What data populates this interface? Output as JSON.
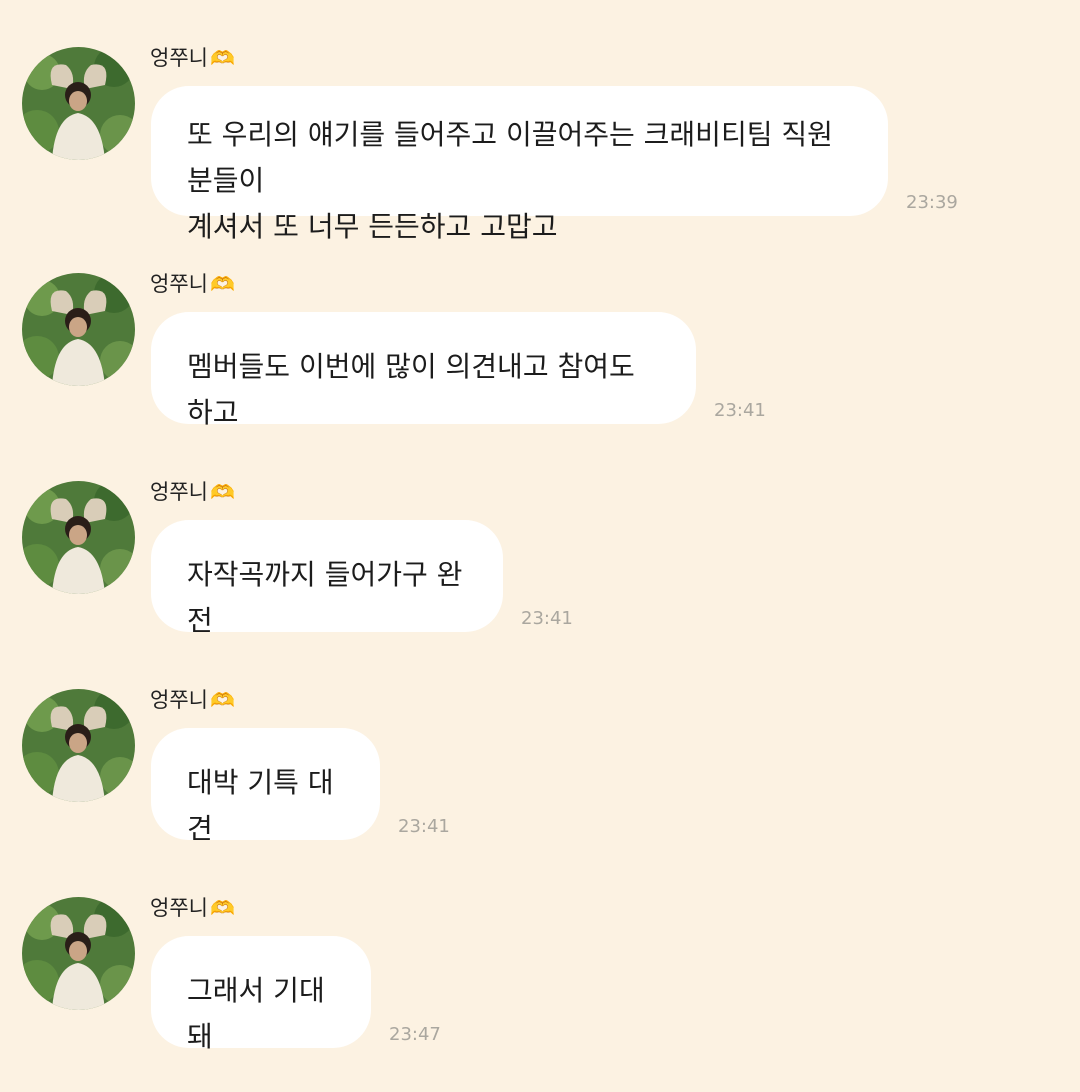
{
  "colors": {
    "background": "#fcf2e2",
    "bubble": "#ffffff",
    "timestamp": "#aaa79f"
  },
  "messages": [
    {
      "sender": "엉쭈니",
      "sender_emoji": "🫶",
      "text": "또 우리의 얘기를 들어주고 이끌어주는 크래비티팀 직원분들이\n계셔서 또 너무 든든하고 고맙고",
      "time": "23:39"
    },
    {
      "sender": "엉쭈니",
      "sender_emoji": "🫶",
      "text": "멤버들도 이번에 많이 의견내고 참여도 하고",
      "time": "23:41"
    },
    {
      "sender": "엉쭈니",
      "sender_emoji": "🫶",
      "text": "자작곡까지 들어가구 완전",
      "time": "23:41"
    },
    {
      "sender": "엉쭈니",
      "sender_emoji": "🫶",
      "text": "대박 기특 대견",
      "time": "23:41"
    },
    {
      "sender": "엉쭈니",
      "sender_emoji": "🫶",
      "text": "그래서 기대돼",
      "time": "23:47"
    }
  ]
}
